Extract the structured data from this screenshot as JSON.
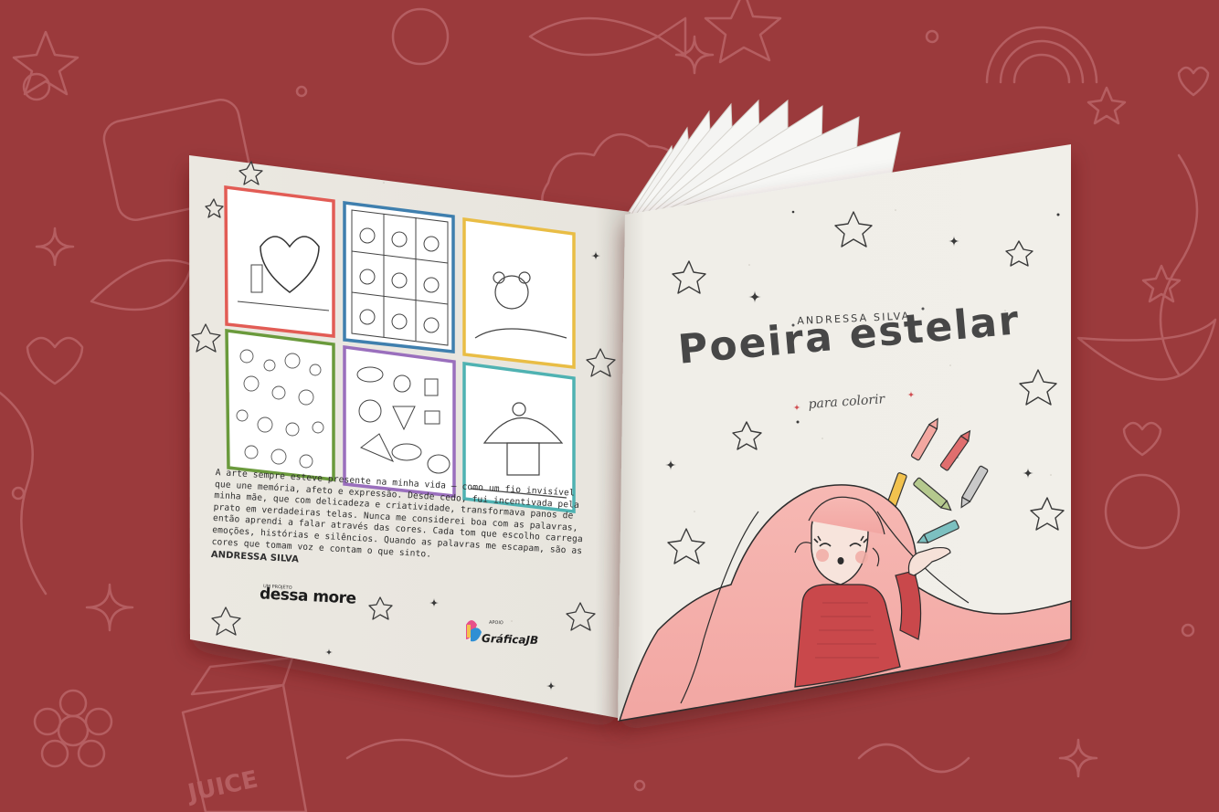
{
  "cover": {
    "author": "ANDRESSA SILVA",
    "title": "Poeira estelar",
    "subtitle": "para colorir"
  },
  "back_cover": {
    "blurb": "A arte sempre esteve presente na minha vida — como um fio invisível que une memória, afeto e expressão. Desde cedo, fui incentivada pela minha mãe, que com delicadeza e criatividade, transformava panos de prato em verdadeiras telas. Nunca me considerei boa com as palavras, então aprendi a falar através das cores. Cada tom que escolho carrega emoções, histórias e silêncios. Quando as palavras me escapam, são as cores que tomam voz e contam o que sinto.",
    "signature": "ANDRESSA SILVA",
    "project_label": "UM PROJETO",
    "project_brand": "dessa more",
    "support_label": "APOIO",
    "support_brand": "GráficaJB"
  },
  "colors": {
    "background": "#9b3a3c",
    "paper": "#efede7",
    "hair": "#f3b1ad",
    "dress": "#c9484b",
    "frame_red": "#e25c55",
    "frame_blue": "#3f7fae",
    "frame_yellow": "#e9bd45",
    "frame_green": "#6a9a3c",
    "frame_purple": "#9a6fbd",
    "frame_teal": "#4fb2b2"
  },
  "thumbnails": [
    {
      "name": "heart-character-thumbnail",
      "icon": "heart-icon"
    },
    {
      "name": "pattern-grid-thumbnail",
      "icon": "grid-icon"
    },
    {
      "name": "bear-character-thumbnail",
      "icon": "bear-icon"
    },
    {
      "name": "doodle-pattern-thumbnail",
      "icon": "doodle-icon"
    },
    {
      "name": "food-pattern-thumbnail",
      "icon": "food-icon"
    },
    {
      "name": "mushroom-house-thumbnail",
      "icon": "mushroom-icon"
    }
  ]
}
